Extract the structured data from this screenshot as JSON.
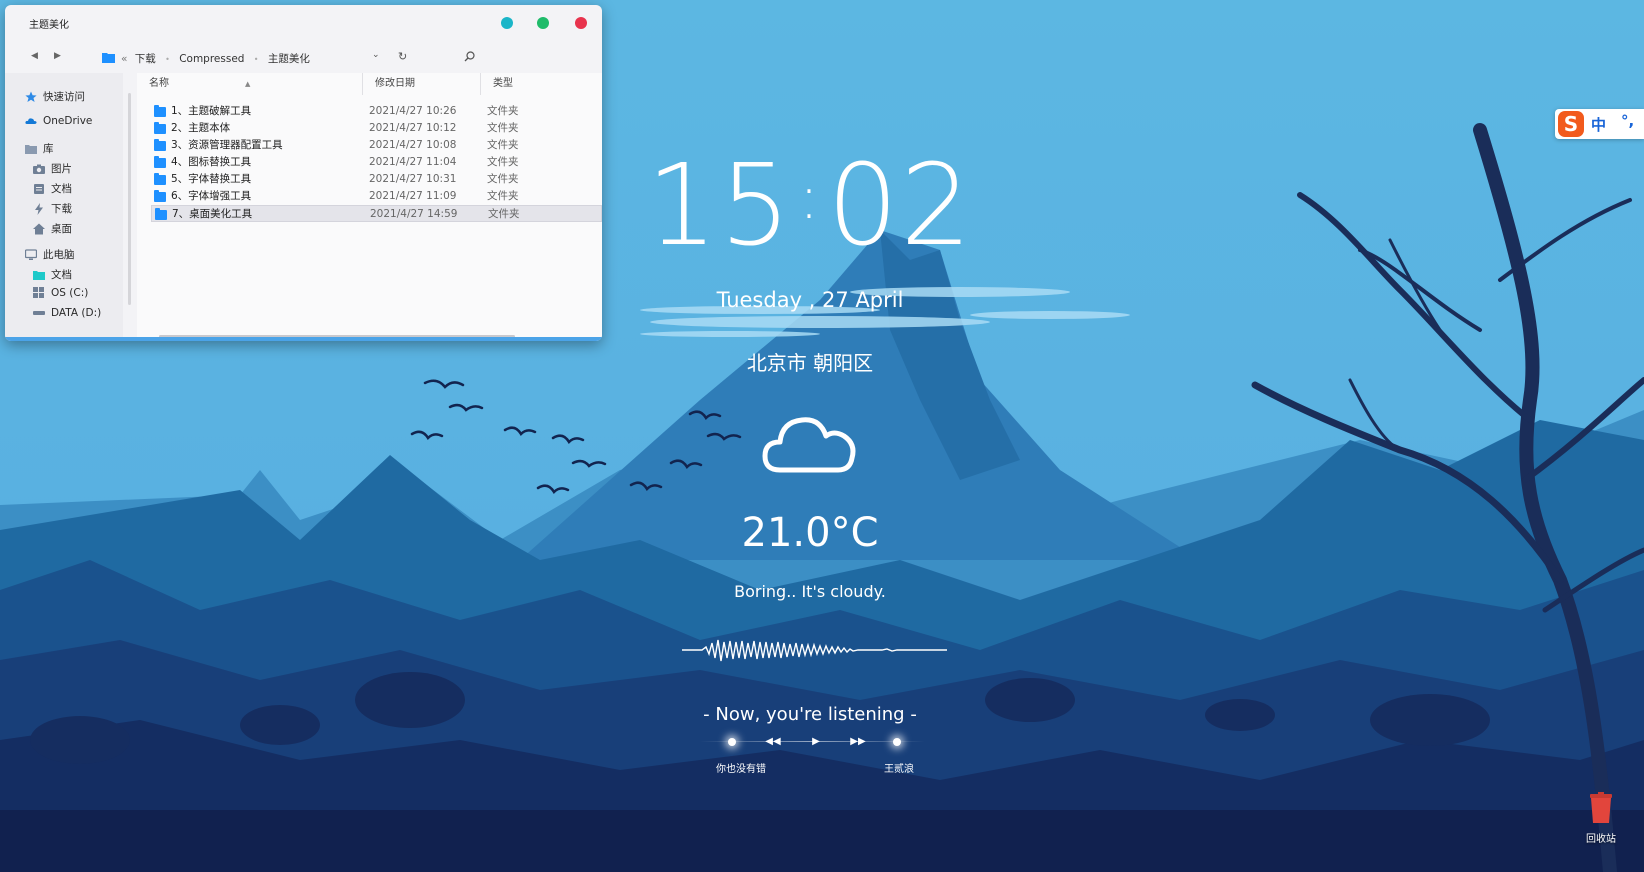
{
  "explorer": {
    "title": "主题美化",
    "breadcrumb": {
      "overflow": "«",
      "items": [
        "下载",
        "Compressed",
        "主题美化"
      ]
    },
    "sidebar": {
      "quick_access": "快速访问",
      "onedrive": "OneDrive",
      "library": "库",
      "library_items": [
        "图片",
        "文档",
        "下载",
        "桌面"
      ],
      "this_pc": "此电脑",
      "pc_items": [
        "文档",
        "OS (C:)",
        "DATA (D:)"
      ]
    },
    "columns": {
      "name": "名称",
      "date": "修改日期",
      "type": "类型"
    },
    "files": [
      {
        "name": "1、主题破解工具",
        "date": "2021/4/27 10:26",
        "type": "文件夹"
      },
      {
        "name": "2、主题本体",
        "date": "2021/4/27 10:12",
        "type": "文件夹"
      },
      {
        "name": "3、资源管理器配置工具",
        "date": "2021/4/27 10:08",
        "type": "文件夹"
      },
      {
        "name": "4、图标替换工具",
        "date": "2021/4/27 11:04",
        "type": "文件夹"
      },
      {
        "name": "5、字体替换工具",
        "date": "2021/4/27 10:31",
        "type": "文件夹"
      },
      {
        "name": "6、字体增强工具",
        "date": "2021/4/27 11:09",
        "type": "文件夹"
      },
      {
        "name": "7、桌面美化工具",
        "date": "2021/4/27 14:59",
        "type": "文件夹",
        "selected": true
      }
    ],
    "colors": {
      "minimize": "#1ab5c8",
      "maximize": "#1fbb6a",
      "close": "#e8334d",
      "folder": "#1e90ff"
    }
  },
  "widget": {
    "hours": "15",
    "minutes": "02",
    "date": "Tuesday , 27 April",
    "city": "北京市 朝阳区",
    "weather_icon": "cloud-icon",
    "temperature": "21.0°C",
    "condition": "Boring.. It's cloudy.",
    "listening": "- Now, you're listening -",
    "song_title": "你也没有错",
    "artist": "王贰浪"
  },
  "ime": {
    "logo": "S",
    "mode": "中",
    "punctuation": "°,"
  },
  "recycle_bin": {
    "label": "回收站",
    "color": "#e2453c"
  }
}
